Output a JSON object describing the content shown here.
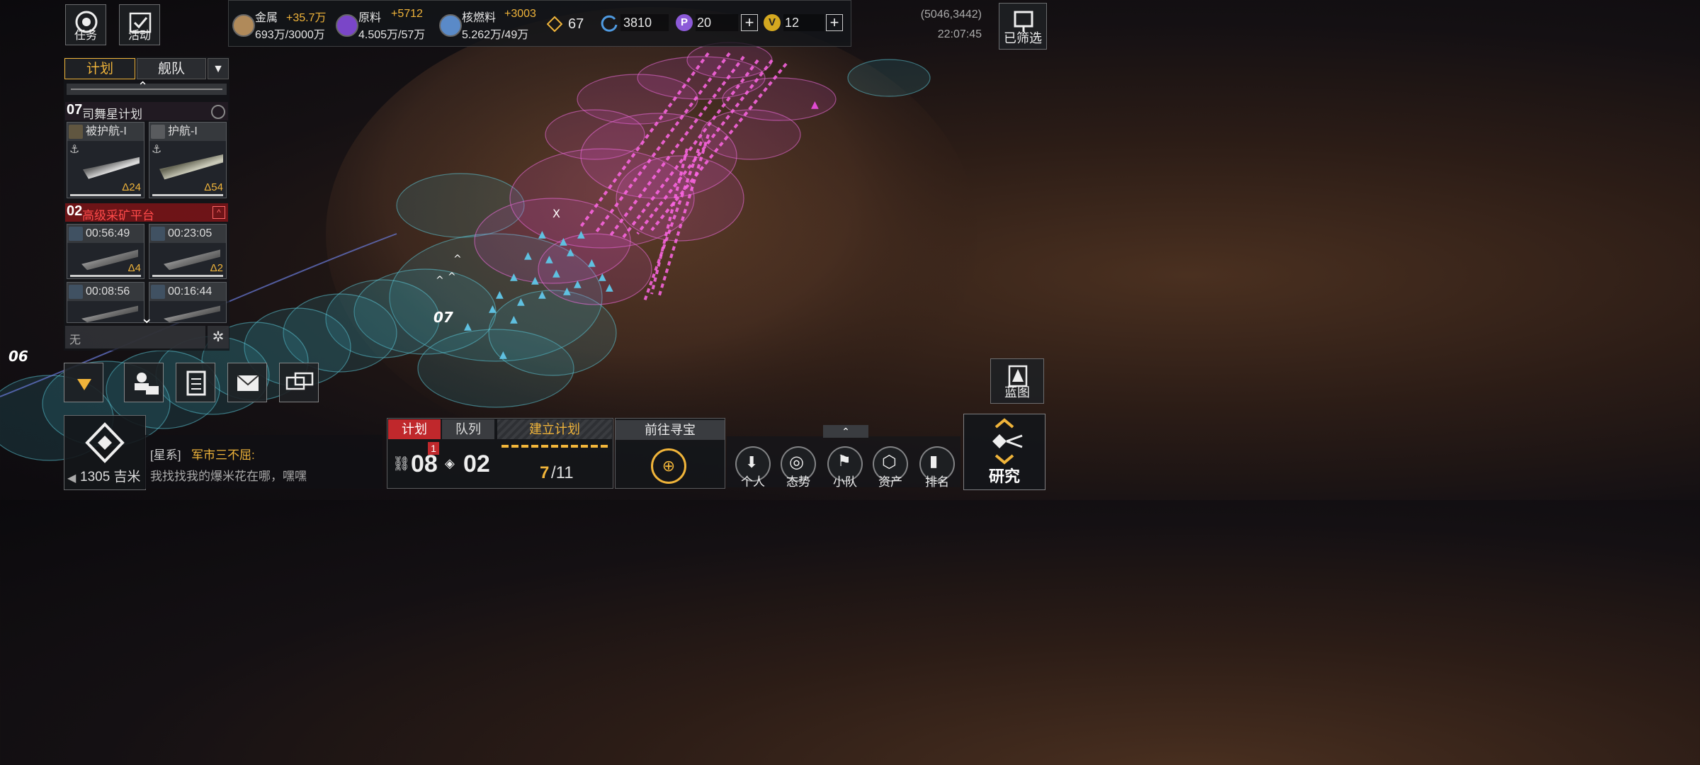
{
  "hud": {
    "task_label": "任务",
    "activity_label": "活动",
    "filter_label": "已筛选",
    "coords": "(5046,3442)",
    "clock": "22:07:45"
  },
  "resources": {
    "metal": {
      "name": "金属",
      "rate": "+35.7万",
      "amount": "693万/3000万"
    },
    "raw": {
      "name": "原料",
      "rate": "+5712",
      "amount": "4.505万/57万"
    },
    "fuel": {
      "name": "核燃料",
      "rate": "+3003",
      "amount": "5.262万/49万"
    },
    "rank_value": "67",
    "currency_a": "3810",
    "currency_b": "20",
    "currency_c": "12"
  },
  "sidebar": {
    "tabs": [
      "计划",
      "舰队"
    ],
    "plan1": {
      "number": "07",
      "name": "司舞星计划"
    },
    "cards1": [
      {
        "title": "被护航-I",
        "count": "Δ24"
      },
      {
        "title": "护航-I",
        "count": "Δ54"
      }
    ],
    "plan2": {
      "number": "02",
      "name": "高级采矿平台"
    },
    "cards2": [
      {
        "title": "00:56:49",
        "count": "Δ4"
      },
      {
        "title": "00:23:05",
        "count": "Δ2"
      },
      {
        "title": "00:08:56",
        "count": ""
      },
      {
        "title": "00:16:44",
        "count": ""
      }
    ],
    "empty_text": "无"
  },
  "map": {
    "marker_07": "07",
    "marker_06": "06",
    "marker_x": "X",
    "blueprint_label": "蓝图"
  },
  "chat": {
    "distance": "1305 吉米",
    "channel": "[星系]",
    "sender": "军市三不屈:",
    "message": "我找找我的爆米花在哪，嘿嘿"
  },
  "bottom": {
    "tab_plan": "计划",
    "tab_queue": "队列",
    "build_plan": "建立计划",
    "treasure": "前往寻宝",
    "plan_count": "08",
    "plan_badge": "1",
    "queue_count": "02",
    "progress_current": "7",
    "progress_total": "/11",
    "nav": [
      "个人",
      "态势",
      "小队",
      "资产",
      "排名"
    ],
    "research": "研究"
  },
  "colors": {
    "accent": "#f0b43a",
    "red": "#c0282c",
    "pink": "#e14bd2",
    "teal": "#4fb8c8"
  }
}
